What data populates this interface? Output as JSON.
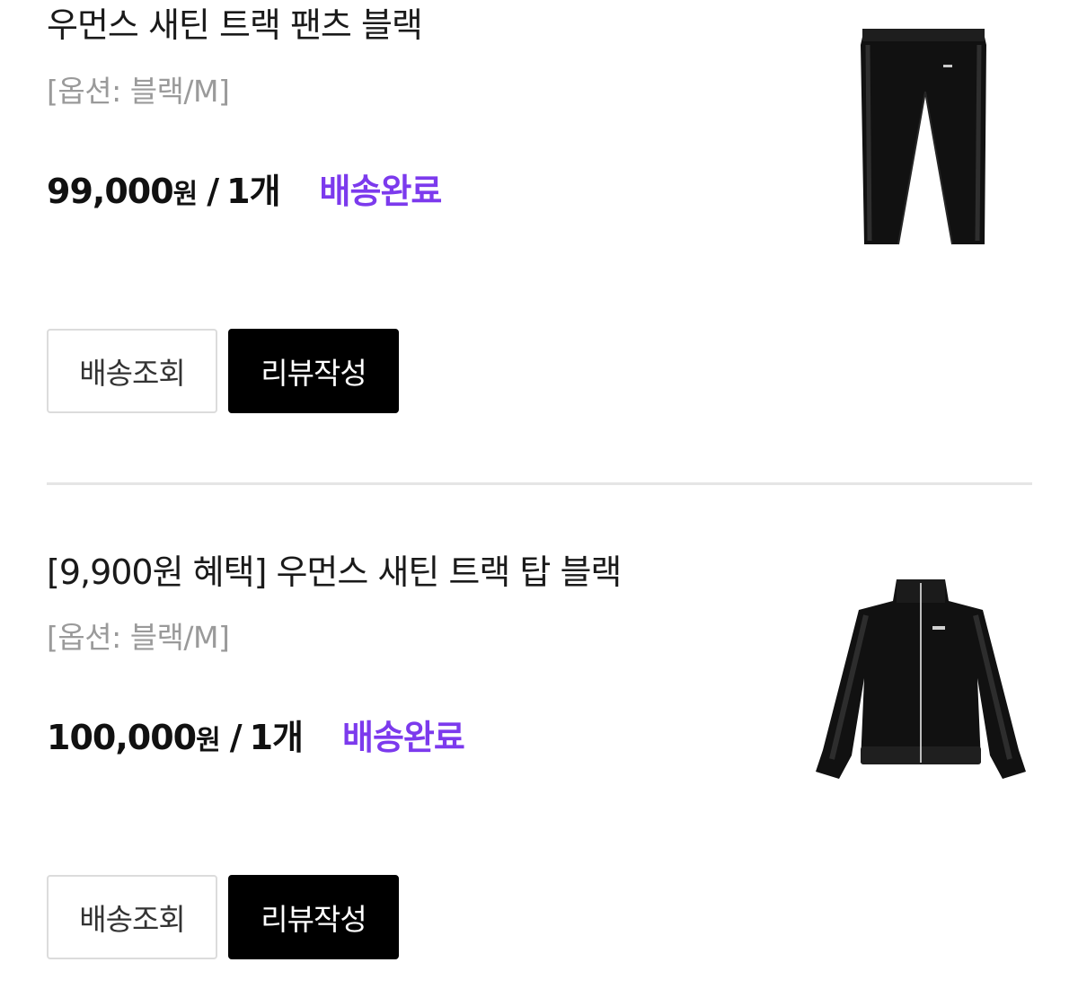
{
  "colors": {
    "status_delivered": "#7c3aed",
    "primary_button_bg": "#000000",
    "divider": "#e5e5e5"
  },
  "orders": [
    {
      "title": "우먼스 새틴 트랙 팬츠 블랙",
      "option": "[옵션: 블랙/M]",
      "price": "99,000",
      "currency": "원",
      "quantity": "1개",
      "status": "배송완료",
      "image_icon": "black-track-pants-image",
      "buttons": {
        "track": "배송조회",
        "review": "리뷰작성"
      }
    },
    {
      "title": "[9,900원 혜택] 우먼스 새틴 트랙 탑 블랙",
      "option": "[옵션: 블랙/M]",
      "price": "100,000",
      "currency": "원",
      "quantity": "1개",
      "status": "배송완료",
      "image_icon": "black-track-jacket-image",
      "buttons": {
        "track": "배송조회",
        "review": "리뷰작성"
      }
    }
  ]
}
